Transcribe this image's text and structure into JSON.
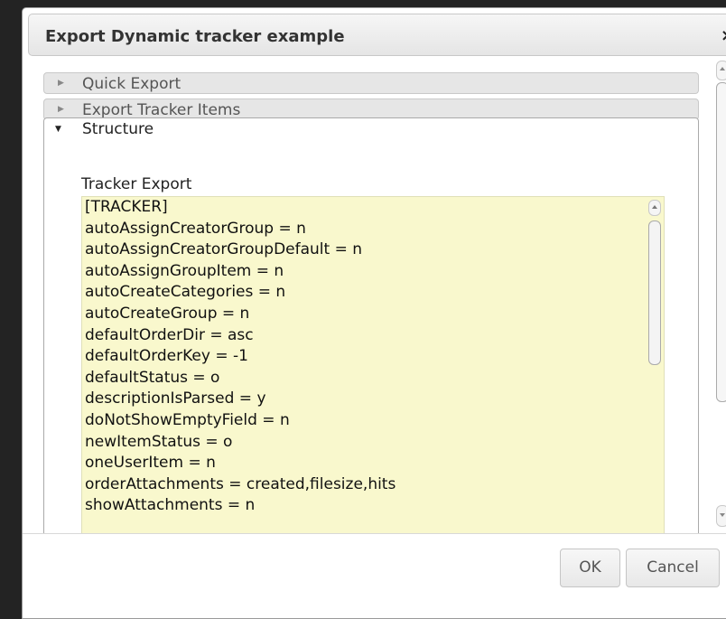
{
  "dialog": {
    "title": "Export Dynamic tracker example",
    "close_glyph": "×"
  },
  "accordion": {
    "sections": [
      {
        "label": "Quick Export",
        "state": "collapsed"
      },
      {
        "label": "Export Tracker Items",
        "state": "collapsed"
      },
      {
        "label": "Structure",
        "state": "expanded"
      }
    ]
  },
  "structure": {
    "field_label": "Tracker Export",
    "lines": [
      "[TRACKER]",
      "autoAssignCreatorGroup = n",
      "autoAssignCreatorGroupDefault = n",
      "autoAssignGroupItem = n",
      "autoCreateCategories = n",
      "autoCreateGroup = n",
      "defaultOrderDir = asc",
      "defaultOrderKey = -1",
      "defaultStatus = o",
      "descriptionIsParsed = y",
      "doNotShowEmptyField = n",
      "newItemStatus = o",
      "oneUserItem = n",
      "orderAttachments = created,filesize,hits",
      "showAttachments = n"
    ]
  },
  "footer": {
    "ok_label": "OK",
    "cancel_label": "Cancel"
  },
  "icons": {
    "collapsed": "triangle-right-icon",
    "expanded": "triangle-down-icon",
    "close": "close-icon"
  }
}
